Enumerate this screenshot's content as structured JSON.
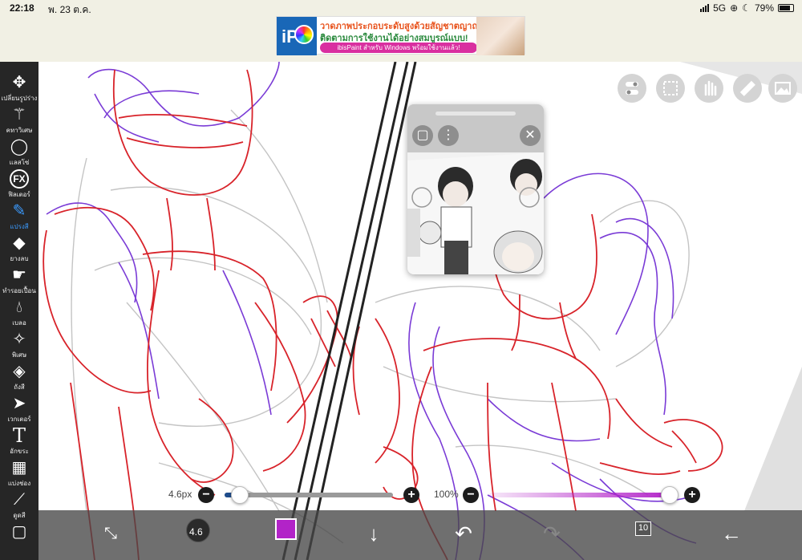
{
  "status_bar": {
    "time": "22:18",
    "date": "พ. 23 ต.ค.",
    "network": "5G",
    "battery": "79%",
    "battery_level": 0.79
  },
  "ad": {
    "brand": "iP",
    "line1": "วาดภาพประกอบระดับสูงด้วยสัญชาตญาณ!",
    "line2": "ติดตามการใช้งานได้อย่างสมบูรณ์แบบ!",
    "cta": "ibisPaint สำหรับ Windows พร้อมใช้งานแล้ว!"
  },
  "toolbar": {
    "tools": [
      {
        "label": "เปลี่ยนรูปร่าง",
        "icon": "move-icon"
      },
      {
        "label": "คทาวิเศษ",
        "icon": "magic-wand-icon"
      },
      {
        "label": "แลสโซ่",
        "icon": "lasso-icon"
      },
      {
        "label": "ฟิลเตอร์",
        "icon": "fx-icon"
      },
      {
        "label": "แปรงสี",
        "icon": "brush-icon"
      },
      {
        "label": "ยางลบ",
        "icon": "eraser-icon"
      },
      {
        "label": "ทำรอยเปื้อน",
        "icon": "smudge-icon"
      },
      {
        "label": "เบลอ",
        "icon": "blur-icon"
      },
      {
        "label": "พิเศษ",
        "icon": "special-icon"
      },
      {
        "label": "ถังสี",
        "icon": "bucket-icon"
      },
      {
        "label": "เวกเตอร์",
        "icon": "vector-icon"
      },
      {
        "label": "อักขระ",
        "icon": "text-icon"
      },
      {
        "label": "แบ่งช่อง",
        "icon": "frame-divider-icon"
      },
      {
        "label": "ดูดสี",
        "icon": "eyedropper-icon"
      },
      {
        "label": "",
        "icon": "canvas-icon"
      }
    ],
    "active_tool": "แปรงสี"
  },
  "top_right_icons": [
    "toggle-icon",
    "selection-icon",
    "hand-icon",
    "ruler-icon",
    "image-icon"
  ],
  "brush_size": {
    "label": "4.6px",
    "value": 4.6,
    "fraction": 0.02,
    "minus": "−",
    "plus": "+"
  },
  "opacity": {
    "label": "100%",
    "value": 100,
    "minus": "−",
    "plus": "+"
  },
  "bottom_bar": {
    "brush_indicator": "4.6",
    "color": "#b223c8",
    "layers_count": "10"
  },
  "colors": {
    "toolbar_bg": "#262626",
    "accent_blue": "#3b9bff",
    "brush_color": "#b223c8",
    "sketch_red": "#d8232a",
    "sketch_purple": "#7a3bd6"
  }
}
